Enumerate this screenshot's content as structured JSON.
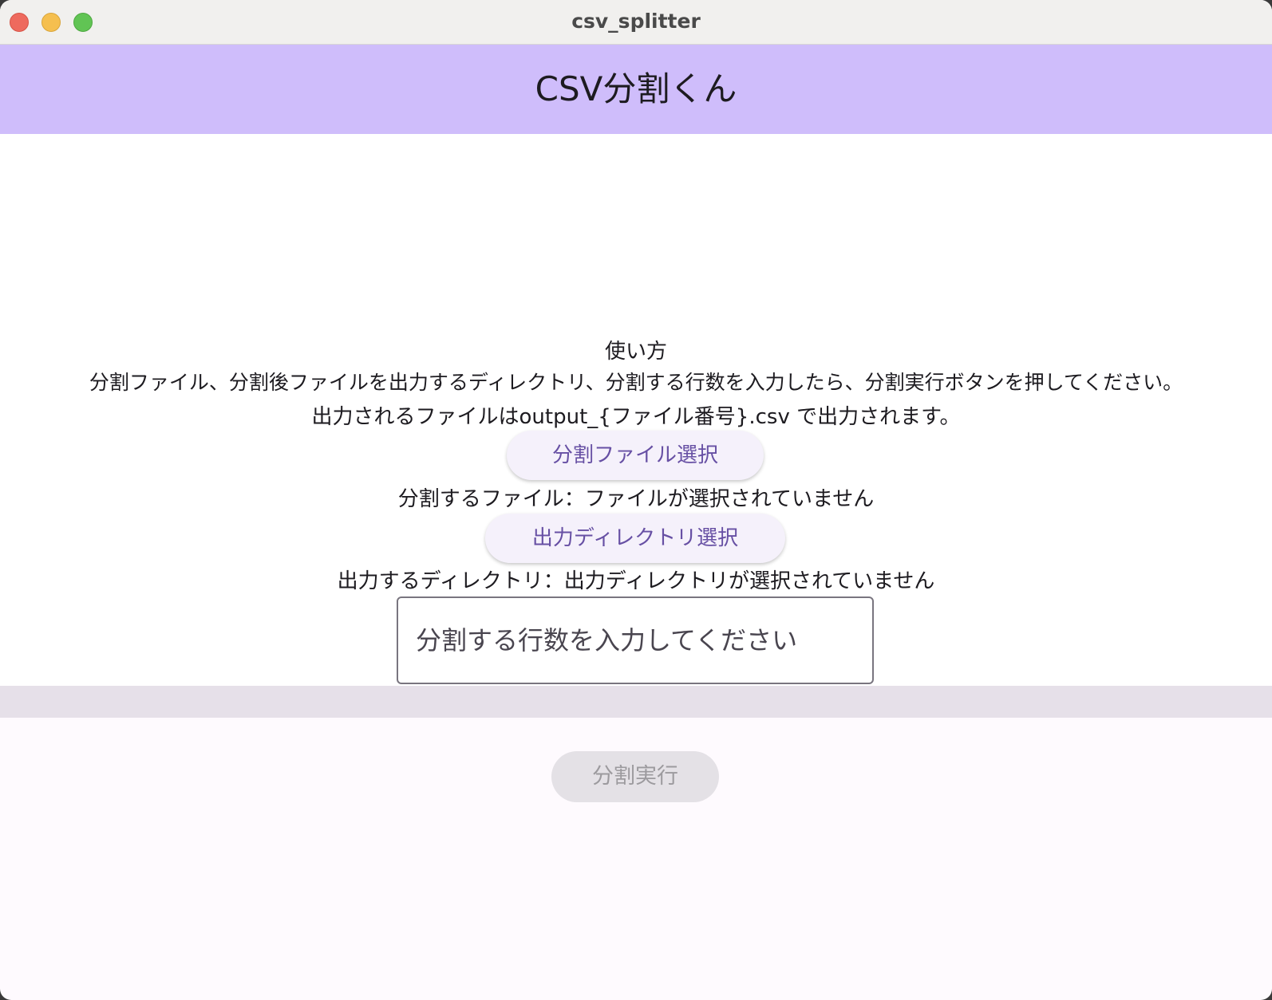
{
  "window": {
    "title": "csv_splitter"
  },
  "appbar": {
    "title": "CSV分割くん"
  },
  "instructions": {
    "heading": "使い方",
    "line1": "分割ファイル、分割後ファイルを出力するディレクトリ、分割する行数を入力したら、分割実行ボタンを押してください。",
    "line2": "出力されるファイルはoutput_{ファイル番号}.csv で出力されます。"
  },
  "file_select": {
    "button_label": "分割ファイル選択",
    "status": "分割するファイル：ファイルが選択されていません"
  },
  "dir_select": {
    "button_label": "出力ディレクトリ選択",
    "status": "出力するディレクトリ：出力ディレクトリが選択されていません"
  },
  "rows_input": {
    "value": "",
    "placeholder": "分割する行数を入力してください"
  },
  "run": {
    "button_label": "分割実行",
    "enabled": false
  },
  "colors": {
    "appbar_bg": "#cfbdfb",
    "primary": "#6750a4",
    "disabled_bg": "#e4e1e6",
    "divider_band": "#e6e0e9"
  }
}
